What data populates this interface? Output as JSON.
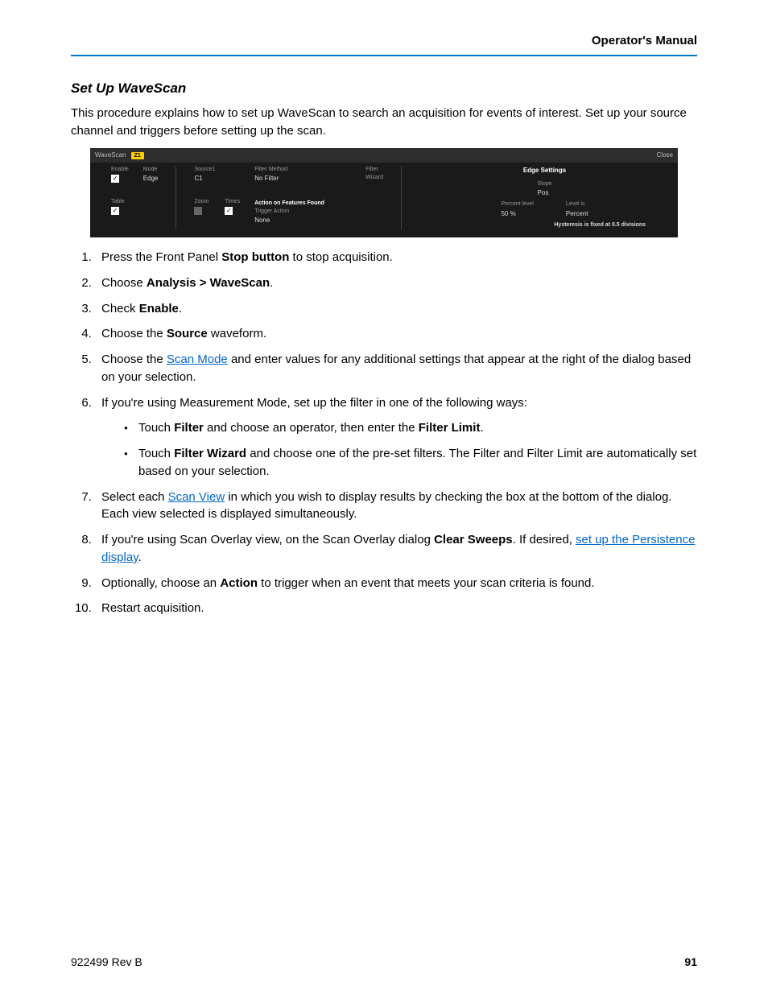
{
  "header": {
    "title": "Operator's Manual"
  },
  "section": {
    "heading": "Set Up WaveScan",
    "intro": "This procedure explains how to set up WaveScan to search an acquisition for events of interest. Set up your source channel and triggers before setting up the scan."
  },
  "wavescan_dialog": {
    "tab_label": "WaveScan",
    "z1_badge": "Z1",
    "close_label": "Close",
    "fields": {
      "enable": {
        "label": "Enable",
        "checked": true
      },
      "mode": {
        "label": "Mode",
        "value": "Edge"
      },
      "source1": {
        "label": "Source1",
        "value": "C1"
      },
      "filter_method": {
        "label": "Filter Method",
        "value": "No Filter"
      },
      "filter_wizard": {
        "label": "Filter",
        "label2": "Wizard"
      },
      "table": {
        "label": "Table",
        "checked": true
      },
      "zoom": {
        "label": "Zoom",
        "checked": false
      },
      "times": {
        "label": "Times",
        "checked": true
      },
      "action_on_features_found": {
        "label": "Action on Features Found"
      },
      "trigger_action": {
        "label": "Trigger Action",
        "value": "None"
      }
    },
    "edge_settings": {
      "title": "Edge Settings",
      "slope": {
        "label": "Slope",
        "value": "Pos"
      },
      "percent_level": {
        "label": "Percent level",
        "value": "50 %"
      },
      "level_is": {
        "label": "Level is",
        "value": "Percent"
      },
      "hysteresis_note": "Hysteresis is fixed at 0.5 divisions"
    }
  },
  "steps": {
    "s1_a": "Press the Front Panel ",
    "s1_b": "Stop button",
    "s1_c": " to stop acquisition.",
    "s2_a": "Choose ",
    "s2_b": "Analysis > WaveScan",
    "s2_c": ".",
    "s3_a": "Check ",
    "s3_b": "Enable",
    "s3_c": ".",
    "s4_a": "Choose the ",
    "s4_b": "Source",
    "s4_c": " waveform.",
    "s5_a": "Choose the ",
    "s5_link": "Scan Mode",
    "s5_b": " and enter values for any additional settings that appear at the right of the dialog based on your selection.",
    "s6": "If you're using Measurement Mode, set up the filter in one of the following ways:",
    "s6_b1_a": "Touch ",
    "s6_b1_b": "Filter",
    "s6_b1_c": " and choose an operator, then enter the ",
    "s6_b1_d": "Filter Limit",
    "s6_b1_e": ".",
    "s6_b2_a": "Touch ",
    "s6_b2_b": "Filter Wizard",
    "s6_b2_c": " and choose one of the pre-set filters. The Filter and Filter Limit are automatically set based on your selection.",
    "s7_a": "Select each ",
    "s7_link": "Scan View",
    "s7_b": " in which you wish to display results by checking the box at the bottom of the dialog. Each view selected is displayed simultaneously.",
    "s8_a": "If you're using Scan Overlay view, on the Scan Overlay dialog ",
    "s8_b": "Clear Sweeps",
    "s8_c": ". If desired, ",
    "s8_link": "set up the Persistence display",
    "s8_d": ".",
    "s9_a": "Optionally, choose an ",
    "s9_b": "Action",
    "s9_c": " to trigger when an event that meets your scan criteria is found.",
    "s10": "Restart acquisition."
  },
  "footer": {
    "doc_ref": "922499 Rev B",
    "page": "91"
  }
}
